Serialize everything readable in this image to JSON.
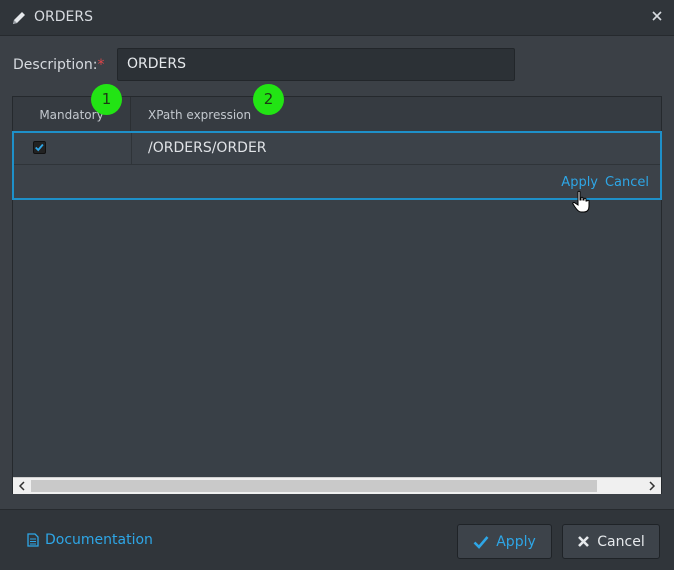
{
  "window": {
    "title": "ORDERS",
    "icon": "pencil-icon",
    "close_icon": "close-icon"
  },
  "form": {
    "description_label": "Description:",
    "required_mark": "*",
    "description_value": "ORDERS"
  },
  "table": {
    "columns": [
      {
        "label": "Mandatory",
        "badge": "1"
      },
      {
        "label": "XPath expression",
        "badge": "2"
      }
    ],
    "rows": [
      {
        "mandatory": true,
        "xpath": "/ORDERS/ORDER"
      }
    ],
    "row_actions": {
      "apply": "Apply",
      "cancel": "Cancel"
    }
  },
  "footer": {
    "documentation": "Documentation",
    "apply_button": "Apply",
    "cancel_button": "Cancel"
  },
  "colors": {
    "accent": "#2ea6e6",
    "badge": "#22e414",
    "required": "#e0454a",
    "row_border": "#1e90c9"
  }
}
